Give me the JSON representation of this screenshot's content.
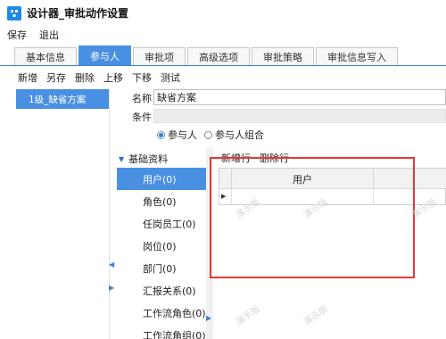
{
  "window": {
    "title": "设计器_审批动作设置",
    "icon": "designer-icon"
  },
  "menu": {
    "items": [
      "保存",
      "退出"
    ]
  },
  "tabs": [
    {
      "label": "基本信息",
      "active": false
    },
    {
      "label": "参与人",
      "active": true
    },
    {
      "label": "审批项",
      "active": false
    },
    {
      "label": "高级选项",
      "active": false
    },
    {
      "label": "审批策略",
      "active": false
    },
    {
      "label": "审批信息写入",
      "active": false
    }
  ],
  "toolbar": {
    "items": [
      "新增",
      "另存",
      "删除",
      "上移",
      "下移",
      "测试"
    ]
  },
  "left_panel": {
    "selected_item": "1级_缺省方案"
  },
  "form": {
    "name_label": "名称",
    "name_value": "缺省方案",
    "condition_label": "条件",
    "radio_participant": "参与人",
    "radio_group": "参与人组合",
    "selected_radio": "参与人"
  },
  "category": {
    "header": "基础资料",
    "items": [
      "用户(0)",
      "角色(0)",
      "任岗员工(0)",
      "岗位(0)",
      "部门(0)",
      "汇报关系(0)",
      "工作流角色(0)",
      "工作流角组(0)"
    ],
    "selected": "用户(0)"
  },
  "grid": {
    "add_label": "新增行",
    "delete_label": "删除行",
    "columns": [
      "用户"
    ],
    "rows": [
      [
        ""
      ]
    ]
  },
  "watermark": "演示版",
  "colors": {
    "accent": "#4a90e2",
    "highlight": "#e53935",
    "tab_border": "#3a82d6"
  }
}
